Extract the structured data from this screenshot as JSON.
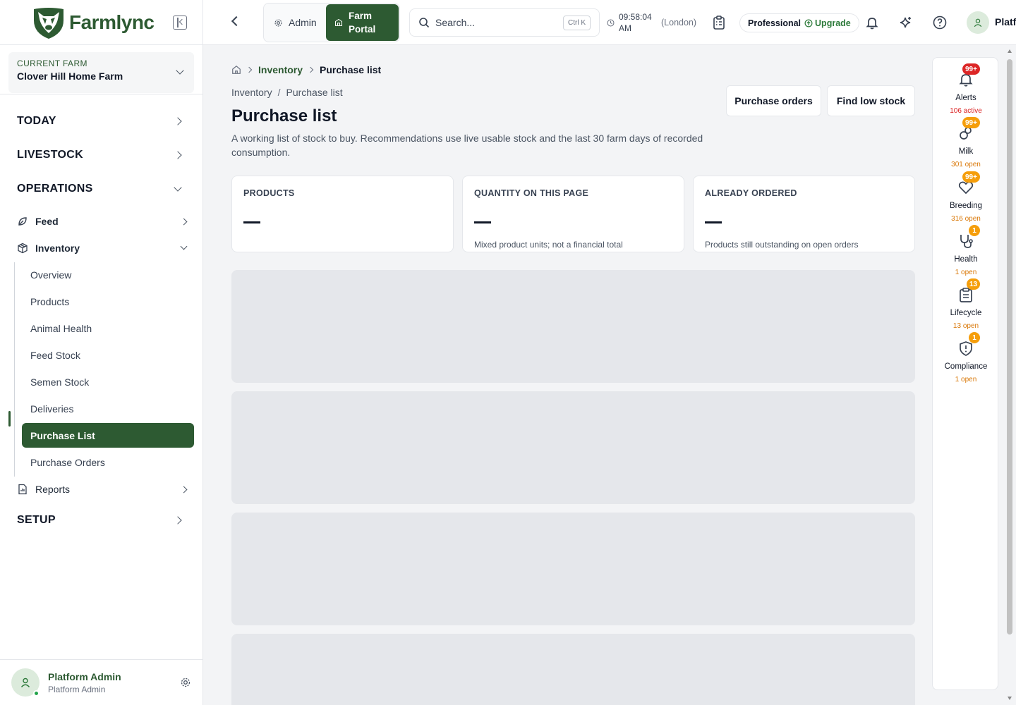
{
  "app": {
    "name": "Farmlync"
  },
  "farm": {
    "label": "CURRENT FARM",
    "name": "Clover Hill Home Farm"
  },
  "nav": {
    "today": "TODAY",
    "livestock": "LIVESTOCK",
    "operations": "OPERATIONS",
    "feed": "Feed",
    "inventory": "Inventory",
    "inventory_items": [
      "Overview",
      "Products",
      "Animal Health",
      "Feed Stock",
      "Semen Stock",
      "Deliveries",
      "Purchase List",
      "Purchase Orders"
    ],
    "reports": "Reports",
    "setup": "SETUP"
  },
  "user": {
    "name": "Platform Admin",
    "role": "Platform Admin",
    "top_name": "Platf"
  },
  "topbar": {
    "admin": "Admin",
    "farm_portal_1": "Farm",
    "farm_portal_2": "Portal",
    "search_placeholder": "Search...",
    "search_shortcut": "Ctrl K",
    "time_1": "09:58:04",
    "time_2": "AM",
    "timezone": "(London)",
    "plan": "Professional",
    "upgrade": "Upgrade"
  },
  "breadcrumb": {
    "parent": "Inventory",
    "current": "Purchase list",
    "sep": "/"
  },
  "page": {
    "title": "Purchase list",
    "description": "A working list of stock to buy. Recommendations use live usable stock and the last 30 farm days of recorded consumption.",
    "btn_orders": "Purchase orders",
    "btn_low_stock": "Find low stock"
  },
  "cards": [
    {
      "label": "PRODUCTS",
      "note": ""
    },
    {
      "label": "QUANTITY ON THIS PAGE",
      "note": "Mixed product units; not a financial total"
    },
    {
      "label": "ALREADY ORDERED",
      "note": "Products still outstanding on open orders"
    }
  ],
  "rail": [
    {
      "label": "Alerts",
      "badge": "99+",
      "count": "106 active",
      "icon": "bell-icon",
      "color": "#dc2626"
    },
    {
      "label": "Milk",
      "badge": "99+",
      "count": "301 open",
      "icon": "milk-icon",
      "color": "#d97706"
    },
    {
      "label": "Breeding",
      "badge": "99+",
      "count": "316 open",
      "icon": "heart-icon",
      "color": "#d97706"
    },
    {
      "label": "Health",
      "badge": "1",
      "count": "1 open",
      "icon": "stethoscope-icon",
      "color": "#d97706"
    },
    {
      "label": "Lifecycle",
      "badge": "13",
      "count": "13 open",
      "icon": "clipboard-icon",
      "color": "#d97706"
    },
    {
      "label": "Compliance",
      "badge": "1",
      "count": "1 open",
      "icon": "shield-icon",
      "color": "#d97706"
    }
  ],
  "colors": {
    "brand": "#2d5a32",
    "alert": "#dc2626",
    "warning": "#f59e0b"
  }
}
